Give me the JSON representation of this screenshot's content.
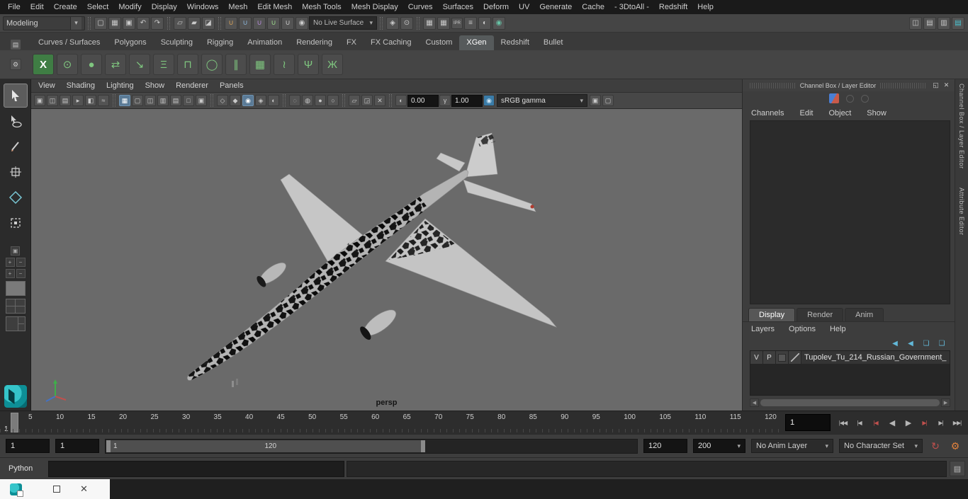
{
  "menubar": {
    "items": [
      "File",
      "Edit",
      "Create",
      "Select",
      "Modify",
      "Display",
      "Windows",
      "Mesh",
      "Edit Mesh",
      "Mesh Tools",
      "Mesh Display",
      "Curves",
      "Surfaces",
      "Deform",
      "UV",
      "Generate",
      "Cache",
      "- 3DtoAll -",
      "Redshift",
      "Help"
    ]
  },
  "statusline": {
    "workspace": "Modeling",
    "no_live_surface": "No Live Surface",
    "ipr_label": "IPR"
  },
  "shelf": {
    "tabs": [
      "Curves / Surfaces",
      "Polygons",
      "Sculpting",
      "Rigging",
      "Animation",
      "Rendering",
      "FX",
      "FX Caching",
      "Custom",
      "XGen",
      "Redshift",
      "Bullet"
    ],
    "active_tab": "XGen"
  },
  "panel": {
    "menus": [
      "View",
      "Shading",
      "Lighting",
      "Show",
      "Renderer",
      "Panels"
    ],
    "exposure": "0.00",
    "gamma": "1.00",
    "view_transform": "sRGB gamma",
    "camera": "persp"
  },
  "channel_box": {
    "title": "Channel Box / Layer Editor",
    "menus": [
      "Channels",
      "Edit",
      "Object",
      "Show"
    ]
  },
  "layer_editor": {
    "tabs": [
      "Display",
      "Render",
      "Anim"
    ],
    "menus": [
      "Layers",
      "Options",
      "Help"
    ],
    "layer": {
      "v": "V",
      "p": "P",
      "name": "Tupolev_Tu_214_Russian_Government_"
    }
  },
  "right_strip": {
    "channel_box": "Channel Box / Layer Editor",
    "attribute_editor": "Attribute Editor"
  },
  "timeline": {
    "ticks": [
      "5",
      "10",
      "15",
      "20",
      "25",
      "30",
      "35",
      "40",
      "45",
      "50",
      "55",
      "60",
      "65",
      "70",
      "75",
      "80",
      "85",
      "90",
      "95",
      "100",
      "105",
      "110",
      "115",
      "120"
    ],
    "start_label": "1",
    "current_frame": "1",
    "playback": [
      "|◀◀",
      "|◀",
      "|◀",
      "◀",
      "▶",
      "▶|",
      "▶|",
      "▶▶|"
    ]
  },
  "range": {
    "playback_start": "1",
    "anim_start": "1",
    "bar_start": "1",
    "bar_end": "120",
    "playback_end": "120",
    "anim_end": "200",
    "anim_layer": "No Anim Layer",
    "character_set": "No Character Set"
  },
  "command_line": {
    "label": "Python"
  }
}
